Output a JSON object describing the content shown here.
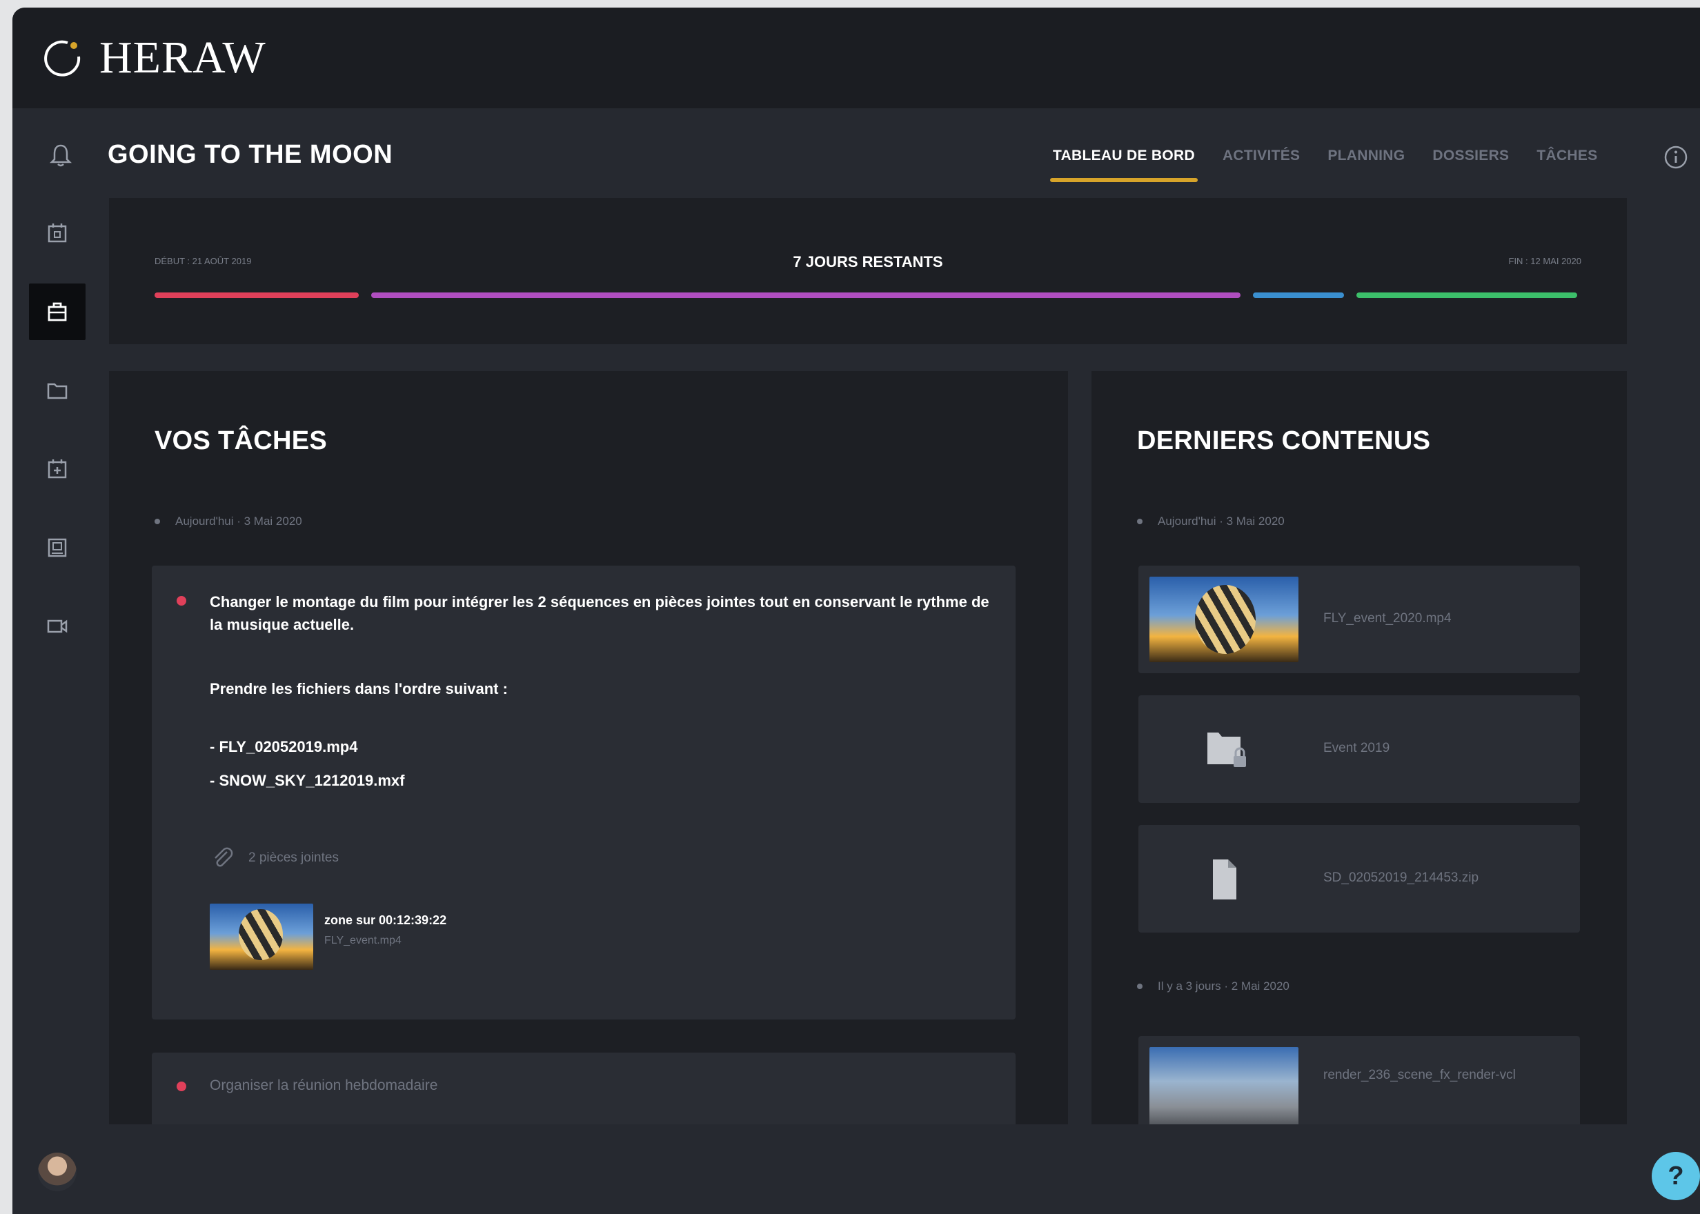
{
  "app": {
    "brand": "HERAW",
    "project_title": "GOING TO THE MOON",
    "accent_color": "#d7a42a"
  },
  "tabs": [
    {
      "label": "TABLEAU DE BORD",
      "active": true
    },
    {
      "label": "ACTIVITÉS",
      "active": false
    },
    {
      "label": "PLANNING",
      "active": false
    },
    {
      "label": "DOSSIERS",
      "active": false
    },
    {
      "label": "TÂCHES",
      "active": false
    }
  ],
  "sidebar": {
    "icons": [
      "calendar-icon",
      "briefcase-icon",
      "folder-icon",
      "calendar-add-icon",
      "board-icon",
      "video-camera-icon"
    ],
    "active_index": 1
  },
  "timeline": {
    "start_label": "DÉBUT : 21 AOÛT 2019",
    "end_label": "FIN : 12 MAI 2020",
    "remaining": "7 JOURS RESTANTS",
    "segment_colors": [
      "#e0405a",
      "#b04ec0",
      "#3a8fd0",
      "#3cbf6a"
    ]
  },
  "tasks_panel": {
    "title": "VOS TÂCHES",
    "date_line": "Aujourd'hui · 3 Mai 2020",
    "task1": {
      "text": "Changer le montage du film pour intégrer les 2 séquences en pièces jointes tout en conservant le rythme de la musique actuelle.",
      "instruction": "Prendre les fichiers dans l'ordre suivant :",
      "file1": "- FLY_02052019.mp4",
      "file2": "- SNOW_SKY_1212019.mxf",
      "attachments_label": "2 pièces jointes",
      "attachment_title": "zone sur 00:12:39:22",
      "attachment_file": "FLY_event.mp4"
    },
    "task2": {
      "text": "Organiser la réunion hebdomadaire"
    }
  },
  "contents_panel": {
    "title": "DERNIERS CONTENUS",
    "date_line_1": "Aujourd'hui · 3 Mai 2020",
    "date_line_2": "Il y a 3 jours · 2 Mai 2020",
    "items": [
      {
        "name": "FLY_event_2020.mp4",
        "icon": "video-thumbnail"
      },
      {
        "name": "Event 2019",
        "icon": "folder-lock-icon"
      },
      {
        "name": "SD_02052019_214453.zip",
        "icon": "file-icon"
      },
      {
        "name": "render_236_scene_fx_render-vcl",
        "icon": "image-thumbnail"
      }
    ]
  },
  "help": {
    "label": "?"
  }
}
